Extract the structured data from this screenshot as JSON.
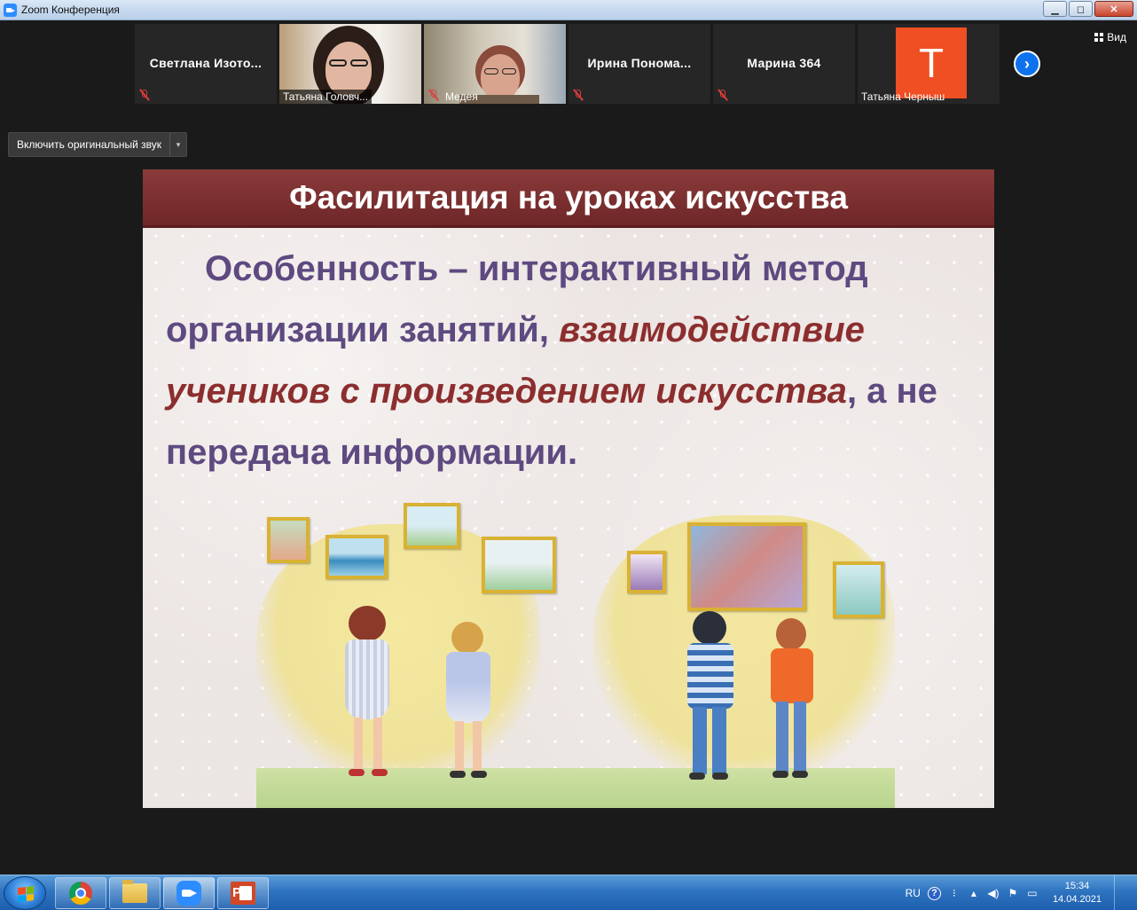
{
  "window": {
    "title": "Zoom Конференция",
    "minimize": "▁",
    "maximize": "◻",
    "close": "✕"
  },
  "participants": [
    {
      "name": "Светлана  Изото...",
      "type": "name"
    },
    {
      "name": "Татьяна Головч...",
      "type": "video"
    },
    {
      "name": "Медея",
      "type": "video"
    },
    {
      "name": "Ирина  Понома...",
      "type": "name"
    },
    {
      "name": "Марина 364",
      "type": "name"
    },
    {
      "name": "Татьяна Черныш",
      "type": "avatar",
      "initial": "Т",
      "avatar_color": "#f04e23"
    }
  ],
  "view_button": "Вид",
  "next_icon": "›",
  "original_sound": {
    "label": "Включить оригинальный звук",
    "dropdown": "▾"
  },
  "slide": {
    "title": "Фасилитация на уроках искусства",
    "text_plain_1": "Особенность – интерактивный метод организации занятий, ",
    "text_emphasis": "взаимодействие учеников с произведением искусства",
    "text_plain_2": ", а не передача информации.",
    "header_color": "#7a2f2f",
    "text_color": "#5e4a80",
    "emphasis_color": "#8c2e2e"
  },
  "taskbar": {
    "apps": [
      "chrome-icon",
      "explorer-icon",
      "zoom-icon",
      "powerpoint-icon"
    ],
    "language": "RU",
    "help": "?",
    "time": "15:34",
    "date": "14.04.2021"
  }
}
